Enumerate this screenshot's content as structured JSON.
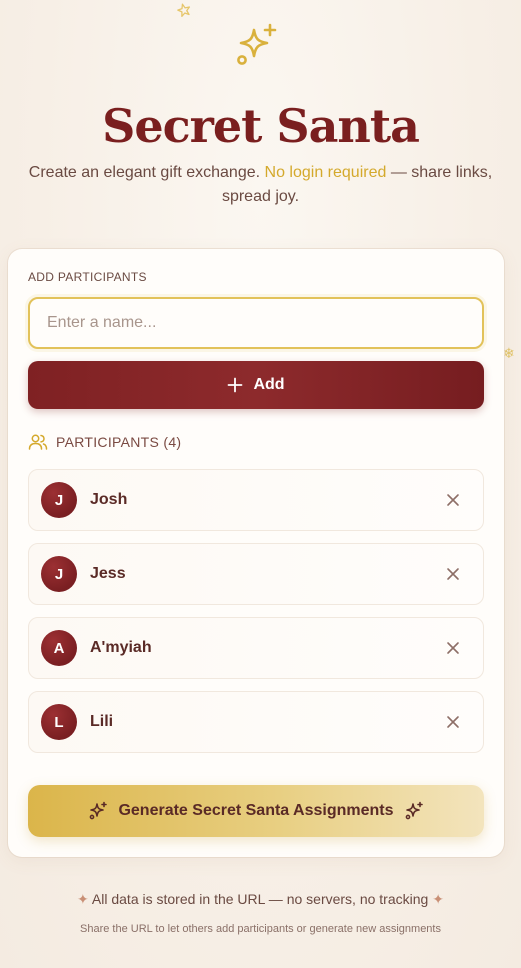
{
  "header": {
    "title": "Secret Santa",
    "subtitle_prefix": "Create an elegant gift exchange.",
    "subtitle_accent": "No login required",
    "subtitle_suffix": "— share links, spread joy."
  },
  "form": {
    "section_label": "ADD PARTICIPANTS",
    "input_placeholder": "Enter a name...",
    "input_value": "",
    "add_label": "Add"
  },
  "participants": {
    "heading": "PARTICIPANTS (4)",
    "items": [
      {
        "initial": "J",
        "name": "Josh"
      },
      {
        "initial": "J",
        "name": "Jess"
      },
      {
        "initial": "A",
        "name": "A'myiah"
      },
      {
        "initial": "L",
        "name": "Lili"
      }
    ]
  },
  "generate": {
    "label": "Generate Secret Santa Assignments"
  },
  "footer": {
    "star_left": "✦",
    "main": "All data is stored in the URL — no servers, no tracking",
    "star_right": "✦",
    "sub": "Share the URL to let others add participants or generate new assignments"
  },
  "colors": {
    "primary": "#7a1f1f",
    "accent": "#d4a92c",
    "background": "#f7efe6"
  },
  "icons": {
    "hero": "sparkles-icon",
    "add": "plus-icon",
    "participants": "users-icon",
    "remove": "close-icon",
    "generate": "sparkles-icon"
  }
}
